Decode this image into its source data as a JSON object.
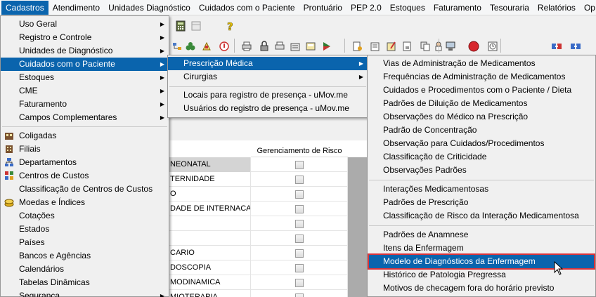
{
  "menubar": {
    "items": [
      "Cadastros",
      "Atendimento",
      "Unidades Diagnóstico",
      "Cuidados com o Paciente",
      "Prontuário",
      "PEP 2.0",
      "Estoques",
      "Faturamento",
      "Tesouraria",
      "Relatórios",
      "Op"
    ]
  },
  "toolbar": {
    "icons": [
      "calculator-icon",
      "calendar-icon",
      "help-icon",
      "tree-icon",
      "binoculars-icon",
      "first-aid-icon",
      "printer-icon",
      "lock-icon",
      "print-preview-icon",
      "open-folder-icon",
      "transfer-icon",
      "document-icon",
      "flag-icon",
      "copy-icon",
      "user-list-icon",
      "bed-icon",
      "phone-icon",
      "monitor-icon",
      "stop-icon",
      "clock-icon",
      "exchange-in-icon",
      "exchange-out-icon"
    ]
  },
  "grid": {
    "header": "Gerenciamento de Risco",
    "rows": [
      {
        "text": "NEONATAL",
        "selected": true
      },
      {
        "text": "TERNIDADE",
        "selected": false
      },
      {
        "text": "O",
        "selected": false
      },
      {
        "text": "DADE DE INTERNACAO",
        "selected": false
      },
      {
        "text": "",
        "selected": false
      },
      {
        "text": "",
        "selected": false
      },
      {
        "text": "CARIO",
        "selected": false
      },
      {
        "text": "DOSCOPIA",
        "selected": false
      },
      {
        "text": "MODINAMICA",
        "selected": false
      },
      {
        "text": "MIOTERAPIA",
        "selected": false
      }
    ]
  },
  "menu1": {
    "items": [
      {
        "label": "Uso Geral",
        "submenu": true,
        "icon": ""
      },
      {
        "label": "Registro e Controle",
        "submenu": true,
        "icon": ""
      },
      {
        "label": "Unidades de Diagnóstico",
        "submenu": true,
        "icon": ""
      },
      {
        "label": "Cuidados com o Paciente",
        "submenu": true,
        "icon": "",
        "highlighted": true
      },
      {
        "label": "Estoques",
        "submenu": true,
        "icon": ""
      },
      {
        "label": "CME",
        "submenu": true,
        "icon": ""
      },
      {
        "label": "Faturamento",
        "submenu": true,
        "icon": ""
      },
      {
        "label": "Campos Complementares",
        "submenu": true,
        "icon": ""
      },
      {
        "label": "Coligadas",
        "submenu": false,
        "icon": "coligadas-icon"
      },
      {
        "label": "Filiais",
        "submenu": false,
        "icon": "filiais-icon"
      },
      {
        "label": "Departamentos",
        "submenu": false,
        "icon": "departamentos-icon"
      },
      {
        "label": "Centros de Custos",
        "submenu": false,
        "icon": "centros-custos-icon"
      },
      {
        "label": "Classificação de Centros de Custos",
        "submenu": false,
        "icon": ""
      },
      {
        "label": "Moedas e Índices",
        "submenu": false,
        "icon": "coins-icon"
      },
      {
        "label": "Cotações",
        "submenu": false,
        "icon": ""
      },
      {
        "label": "Estados",
        "submenu": false,
        "icon": ""
      },
      {
        "label": "Países",
        "submenu": false,
        "icon": ""
      },
      {
        "label": "Bancos e Agências",
        "submenu": false,
        "icon": ""
      },
      {
        "label": "Calendários",
        "submenu": false,
        "icon": ""
      },
      {
        "label": "Tabelas Dinâmicas",
        "submenu": false,
        "icon": ""
      },
      {
        "label": "Segurança",
        "submenu": true,
        "icon": ""
      }
    ]
  },
  "menu2": {
    "items": [
      {
        "label": "Prescrição Médica",
        "submenu": true,
        "highlighted": true
      },
      {
        "label": "Cirurgias",
        "submenu": true
      },
      {
        "label": "Locais para registro de presença - uMov.me",
        "submenu": false
      },
      {
        "label": "Usuários do registro de presença - uMov.me",
        "submenu": false
      }
    ]
  },
  "menu3": {
    "items": [
      "Vias de Administração de Medicamentos",
      "Frequências de Administração de Medicamentos",
      "Cuidados e Procedimentos com o Paciente / Dieta",
      "Padrões de Diluição de Medicamentos",
      "Observações do Médico na Prescrição",
      "Padrão de Concentração",
      "Observação para Cuidados/Procedimentos",
      "Classificação de Criticidade",
      "Observações Padrões",
      "Interações Medicamentosas",
      "Padrões de Prescrição",
      "Classificação de Risco da Interação Medicamentosa",
      "Padrões de Anamnese",
      "Itens da Enfermagem",
      "Modelo de Diagnósticos da Enfermagem",
      "Histórico de Patologia Pregressa",
      "Motivos de checagem fora do horário previsto"
    ],
    "selected": "Modelo de Diagnósticos da Enfermagem"
  },
  "colors": {
    "highlight": "#0a64ad",
    "selection_outline": "#d9343a"
  }
}
